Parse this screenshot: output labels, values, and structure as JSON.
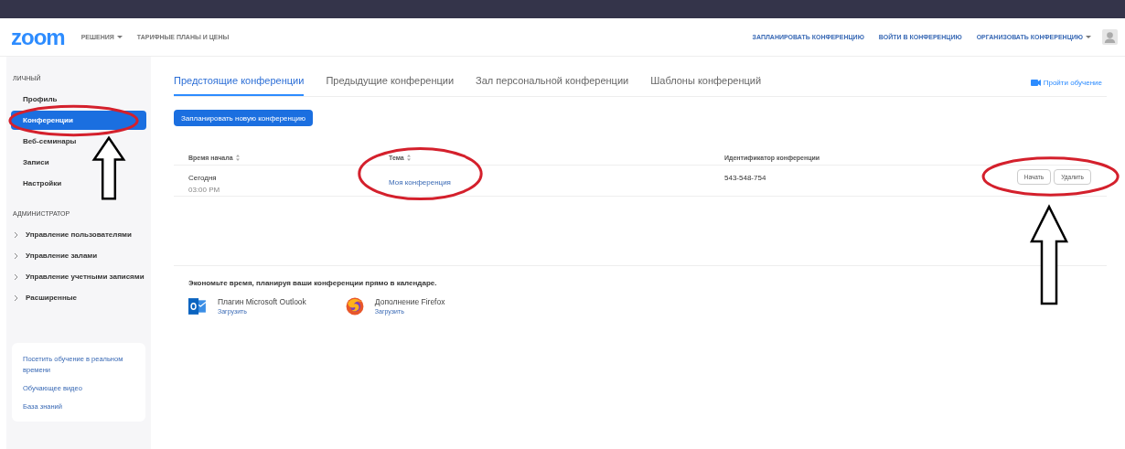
{
  "header": {
    "logo": "zoom",
    "nav": [
      {
        "label": "РЕШЕНИЯ",
        "dropdown": true
      },
      {
        "label": "ТАРИФНЫЕ ПЛАНЫ И ЦЕНЫ",
        "dropdown": false
      }
    ],
    "actions": [
      {
        "label": "ЗАПЛАНИРОВАТЬ КОНФЕРЕНЦИЮ",
        "dropdown": false
      },
      {
        "label": "ВОЙТИ В КОНФЕРЕНЦИЮ",
        "dropdown": false
      },
      {
        "label": "ОРГАНИЗОВАТЬ КОНФЕРЕНЦИЮ",
        "dropdown": true
      }
    ]
  },
  "sidebar": {
    "sections": [
      {
        "title": "ЛИЧНЫЙ",
        "items": [
          {
            "label": "Профиль",
            "selected": false,
            "expandable": false,
            "annotated": false
          },
          {
            "label": "Конференции",
            "selected": true,
            "expandable": false,
            "annotated": true
          },
          {
            "label": "Веб-семинары",
            "selected": false,
            "expandable": false,
            "annotated": false
          },
          {
            "label": "Записи",
            "selected": false,
            "expandable": false,
            "annotated": false
          },
          {
            "label": "Настройки",
            "selected": false,
            "expandable": false,
            "annotated": false
          }
        ]
      },
      {
        "title": "АДМИНИСТРАТОР",
        "items": [
          {
            "label": "Управление пользователями",
            "selected": false,
            "expandable": true,
            "annotated": false
          },
          {
            "label": "Управление залами",
            "selected": false,
            "expandable": true,
            "annotated": false
          },
          {
            "label": "Управление учетными записями",
            "selected": false,
            "expandable": true,
            "annotated": false
          },
          {
            "label": "Расширенные",
            "selected": false,
            "expandable": true,
            "annotated": false
          }
        ]
      }
    ],
    "help_links": [
      "Посетить обучение в реальном времени",
      "Обучающее видео",
      "База знаний"
    ]
  },
  "main": {
    "tabs": [
      {
        "label": "Предстоящие конференции",
        "selected": true
      },
      {
        "label": "Предыдущие конференции",
        "selected": false
      },
      {
        "label": "Зал персональной конференции",
        "selected": false
      },
      {
        "label": "Шаблоны конференций",
        "selected": false
      }
    ],
    "training_link": "Пройти обучение",
    "new_button": "Запланировать новую конференцию",
    "table": {
      "columns": [
        {
          "label": "Время начала",
          "sortable": true
        },
        {
          "label": "Тема",
          "sortable": true
        },
        {
          "label": "Идентификатор конференции",
          "sortable": false
        }
      ],
      "rows": [
        {
          "day": "Сегодня",
          "time": "03:00 PM",
          "topic": "Моя конференция",
          "topic_circled": true,
          "meeting_id": "543-548-754",
          "buttons": [
            "Начать",
            "Удалить"
          ],
          "buttons_annotated": true
        }
      ]
    },
    "calendar": {
      "title": "Экономьте время, планируя ваши конференции прямо в календаре.",
      "plugins": [
        {
          "kind": "outlook",
          "name": "Плагин Microsoft Outlook",
          "link": "Загрузить"
        },
        {
          "kind": "firefox",
          "name": "Дополнение Firefox",
          "link": "Загрузить"
        }
      ]
    }
  }
}
